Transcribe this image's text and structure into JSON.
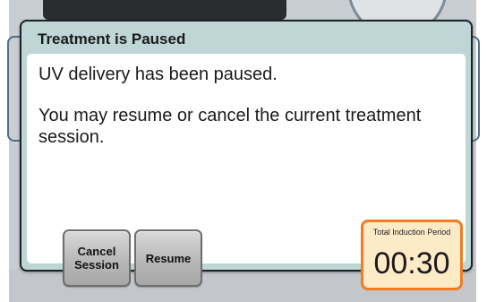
{
  "dialog": {
    "title": "Treatment is Paused",
    "message_line1": "UV delivery has been paused.",
    "message_line2": "You may resume or cancel the current treatment session."
  },
  "buttons": {
    "cancel_label": "Cancel\nSession",
    "resume_label": "Resume"
  },
  "timer": {
    "label": "Total Induction Period",
    "value": "00:30"
  },
  "colors": {
    "dialog_header": "#bed6d6",
    "timer_border": "#f07d22",
    "timer_fill": "#fdebc8"
  }
}
